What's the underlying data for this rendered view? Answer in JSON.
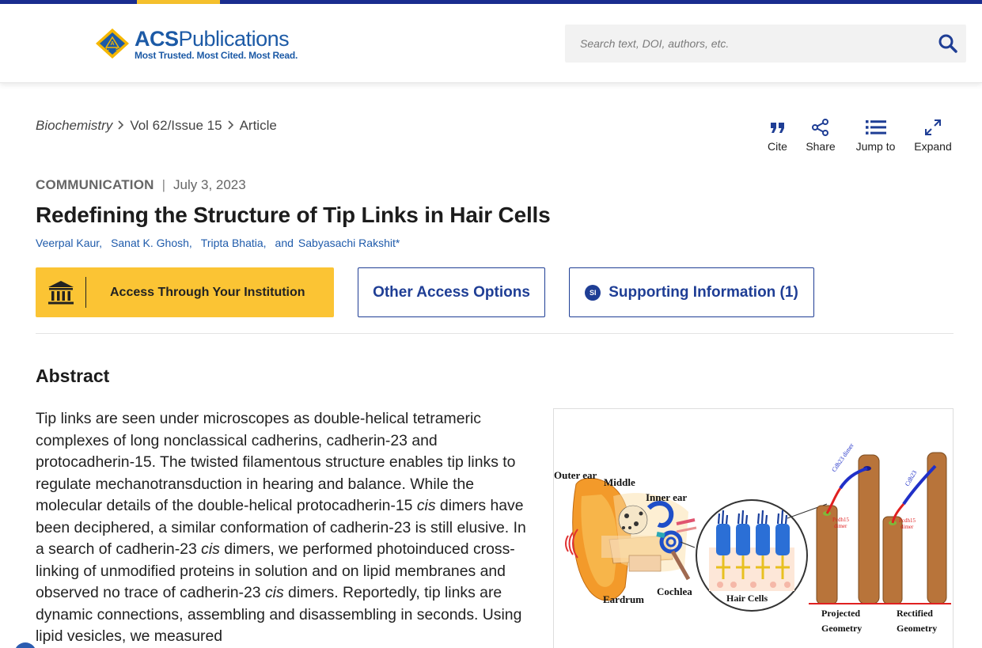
{
  "brand": {
    "name_bold": "ACS",
    "name_rest": "Publications",
    "tagline": "Most Trusted. Most Cited. Most Read.",
    "primary_color": "#1c5aa6",
    "accent_color": "#f5c02c"
  },
  "search": {
    "placeholder": "Search text, DOI, authors, etc.",
    "button_icon": "search-icon"
  },
  "breadcrumb": {
    "journal": "Biochemistry",
    "issue": "Vol 62/Issue 15",
    "page": "Article"
  },
  "actions": [
    {
      "label": "Cite",
      "icon": "quote-icon"
    },
    {
      "label": "Share",
      "icon": "share-icon"
    },
    {
      "label": "Jump to",
      "icon": "list-icon"
    },
    {
      "label": "Expand",
      "icon": "expand-icon"
    }
  ],
  "article": {
    "type": "COMMUNICATION",
    "date": "July 3, 2023",
    "title": "Redefining the Structure of Tip Links in Hair Cells",
    "authors": [
      "Veerpal Kaur,",
      "Sanat K. Ghosh,",
      "Tripta Bhatia,"
    ],
    "authors_and": "and",
    "last_author": "Sabyasachi Rakshit*"
  },
  "buttons": {
    "access": "Access Through Your Institution",
    "other": "Other Access Options",
    "si_badge": "SI",
    "si": "Supporting Information (1)"
  },
  "abstract": {
    "heading": "Abstract",
    "p1": "Tip links are seen under microscopes as double-helical tetrameric complexes of long nonclassical cadherins, cadherin-23 and protocadherin-15. The twisted filamentous structure enables tip links to regulate mechanotransduction in hearing and balance. While the molecular details of the double-helical protocadherin-15 ",
    "cis1": "cis",
    "p2": " dimers have been deciphered, a similar conformation of cadherin-23 is still elusive. In a search of cadherin-23 ",
    "cis2": "cis",
    "p3": " dimers, we performed photoinduced cross-linking of unmodified proteins in solution and on lipid membranes and observed no trace of cadherin-23 ",
    "cis3": "cis",
    "p4": " dimers. Reportedly, tip links are dynamic connections, assembling and disassembling in seconds. Using lipid vesicles, we measured"
  },
  "figure": {
    "outer_ear": "Outer ear",
    "middle": "Middle",
    "inner_ear": "Inner ear",
    "eardrum": "Eardrum",
    "cochlea": "Cochlea",
    "hair_cells": "Hair Cells",
    "cdh23_dimer": "Cdh23 dimer",
    "pcdh15_dimer_1": "Pcdh15",
    "pcdh15_dimer_2": "dimer",
    "projected_1": "Projected",
    "projected_2": "Geometry",
    "rectified_1": "Rectified",
    "rectified_2": "Geometry",
    "cdh23_label_2": "Cdh23"
  }
}
